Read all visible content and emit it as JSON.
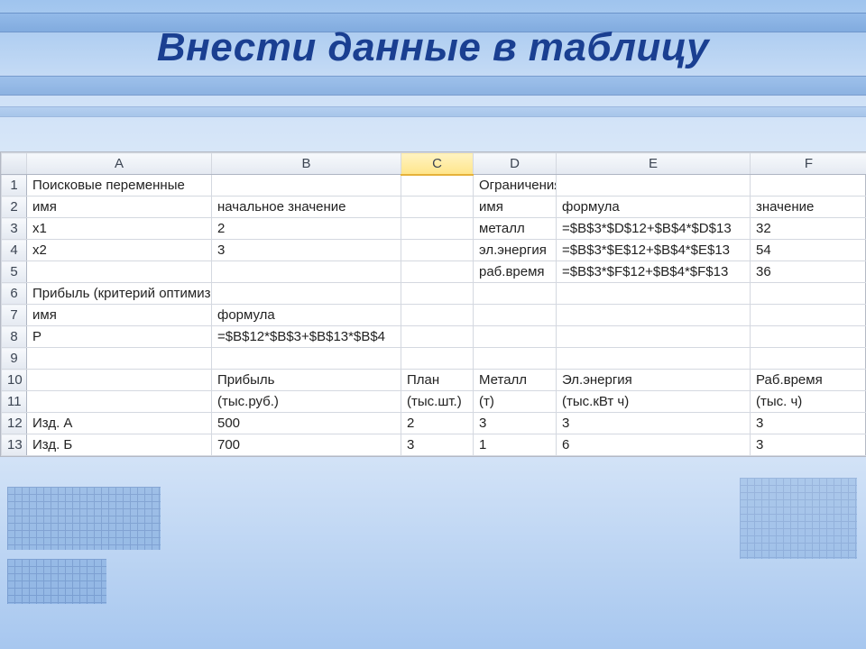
{
  "slide": {
    "title": "Внести данные в таблицу"
  },
  "sheet": {
    "col_headers": [
      "A",
      "B",
      "C",
      "D",
      "E",
      "F"
    ],
    "active_col_index": 2,
    "rows": [
      {
        "n": "1",
        "cells": [
          "Поисковые переменные",
          "",
          "",
          "Ограничения",
          "",
          ""
        ]
      },
      {
        "n": "2",
        "cells": [
          "имя",
          "начальное значение",
          "",
          "имя",
          "формула",
          "значение"
        ]
      },
      {
        "n": "3",
        "cells": [
          "x1",
          "2",
          "",
          "металл",
          "=$B$3*$D$12+$B$4*$D$13",
          "32"
        ]
      },
      {
        "n": "4",
        "cells": [
          "x2",
          "3",
          "",
          "эл.энергия",
          "=$B$3*$E$12+$B$4*$E$13",
          "54"
        ]
      },
      {
        "n": "5",
        "cells": [
          "",
          "",
          "",
          "раб.время",
          "=$B$3*$F$12+$B$4*$F$13",
          "36"
        ]
      },
      {
        "n": "6",
        "cells": [
          "Прибыль (критерий оптимизации)",
          "",
          "",
          "",
          "",
          ""
        ]
      },
      {
        "n": "7",
        "cells": [
          "имя",
          "формула",
          "",
          "",
          "",
          ""
        ]
      },
      {
        "n": "8",
        "cells": [
          "P",
          "=$B$12*$B$3+$B$13*$B$4",
          "",
          "",
          "",
          ""
        ]
      },
      {
        "n": "9",
        "cells": [
          "",
          "",
          "",
          "",
          "",
          ""
        ]
      },
      {
        "n": "10",
        "cells": [
          "",
          "Прибыль",
          "План",
          "Металл",
          "Эл.энергия",
          "Раб.время"
        ]
      },
      {
        "n": "11",
        "cells": [
          "",
          "(тыс.руб.)",
          "(тыс.шт.)",
          "(т)",
          "(тыс.кВт ч)",
          "(тыс. ч)"
        ]
      },
      {
        "n": "12",
        "cells": [
          "Изд. А",
          "500",
          "2",
          "3",
          "3",
          "3"
        ]
      },
      {
        "n": "13",
        "cells": [
          "Изд. Б",
          "700",
          "3",
          "1",
          "6",
          "3"
        ]
      }
    ]
  }
}
